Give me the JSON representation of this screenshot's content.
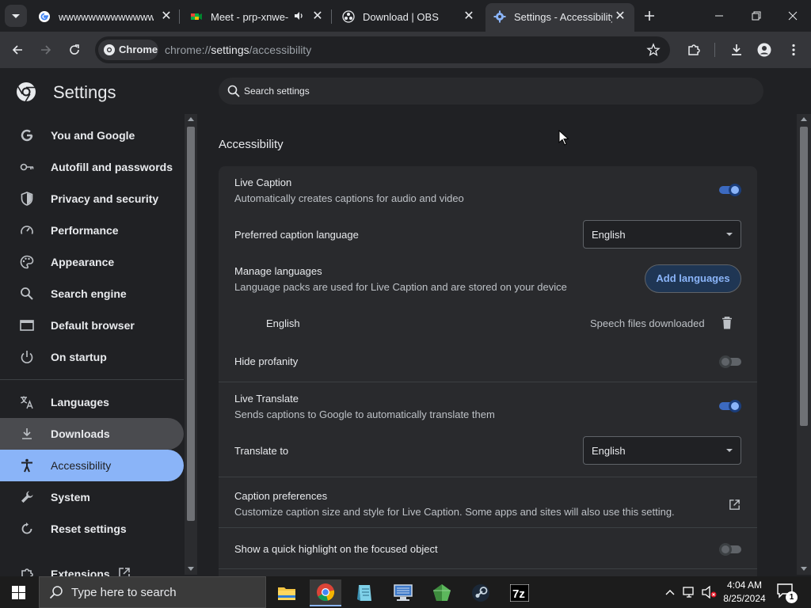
{
  "tabs": [
    {
      "title": "wwwwwwwwwwwwwwww",
      "active": false
    },
    {
      "title": "Meet - prp-xnwe-y",
      "active": false
    },
    {
      "title": "Download | OBS",
      "active": false
    },
    {
      "title": "Settings - Accessibility",
      "active": true
    }
  ],
  "toolbar": {
    "chip_label": "Chrome",
    "url_prefix": "chrome://",
    "url_host": "settings",
    "url_path": "/accessibility"
  },
  "settings": {
    "app_title": "Settings",
    "search_placeholder": "Search settings",
    "nav": [
      {
        "label": "You and Google",
        "icon": "google-icon"
      },
      {
        "label": "Autofill and passwords",
        "icon": "key-icon"
      },
      {
        "label": "Privacy and security",
        "icon": "shield-icon"
      },
      {
        "label": "Performance",
        "icon": "speedometer-icon"
      },
      {
        "label": "Appearance",
        "icon": "palette-icon"
      },
      {
        "label": "Search engine",
        "icon": "search-icon"
      },
      {
        "label": "Default browser",
        "icon": "browser-window-icon"
      },
      {
        "label": "On startup",
        "icon": "power-icon"
      },
      {
        "label": "Languages",
        "icon": "translate-icon"
      },
      {
        "label": "Downloads",
        "icon": "download-icon"
      },
      {
        "label": "Accessibility",
        "icon": "accessibility-icon"
      },
      {
        "label": "System",
        "icon": "wrench-icon"
      },
      {
        "label": "Reset settings",
        "icon": "reset-icon"
      },
      {
        "label": "Extensions",
        "icon": "puzzle-icon"
      }
    ],
    "selected_nav": "Accessibility",
    "hovered_nav": "Downloads",
    "section_title": "Accessibility",
    "live_caption": {
      "title": "Live Caption",
      "subtitle": "Automatically creates captions for audio and video",
      "enabled": true
    },
    "caption_language": {
      "title": "Preferred caption language",
      "value": "English"
    },
    "manage_languages": {
      "title": "Manage languages",
      "subtitle": "Language packs are used for Live Caption and are stored on your device",
      "button": "Add languages",
      "entry_name": "English",
      "entry_status": "Speech files downloaded"
    },
    "hide_profanity": {
      "title": "Hide profanity",
      "enabled": false
    },
    "live_translate": {
      "title": "Live Translate",
      "subtitle": "Sends captions to Google to automatically translate them",
      "enabled": true
    },
    "translate_to": {
      "title": "Translate to",
      "value": "English"
    },
    "caption_prefs": {
      "title": "Caption preferences",
      "subtitle": "Customize caption size and style for Live Caption. Some apps and sites will also use this setting."
    },
    "focus_highlight": {
      "title": "Show a quick highlight on the focused object",
      "enabled": false
    }
  },
  "taskbar": {
    "search_placeholder": "Type here to search",
    "time": "4:04 AM",
    "date": "8/25/2024",
    "notification_count": "1"
  },
  "colors": {
    "accent": "#8ab4f8",
    "background": "#202124",
    "card": "#292a2d"
  }
}
